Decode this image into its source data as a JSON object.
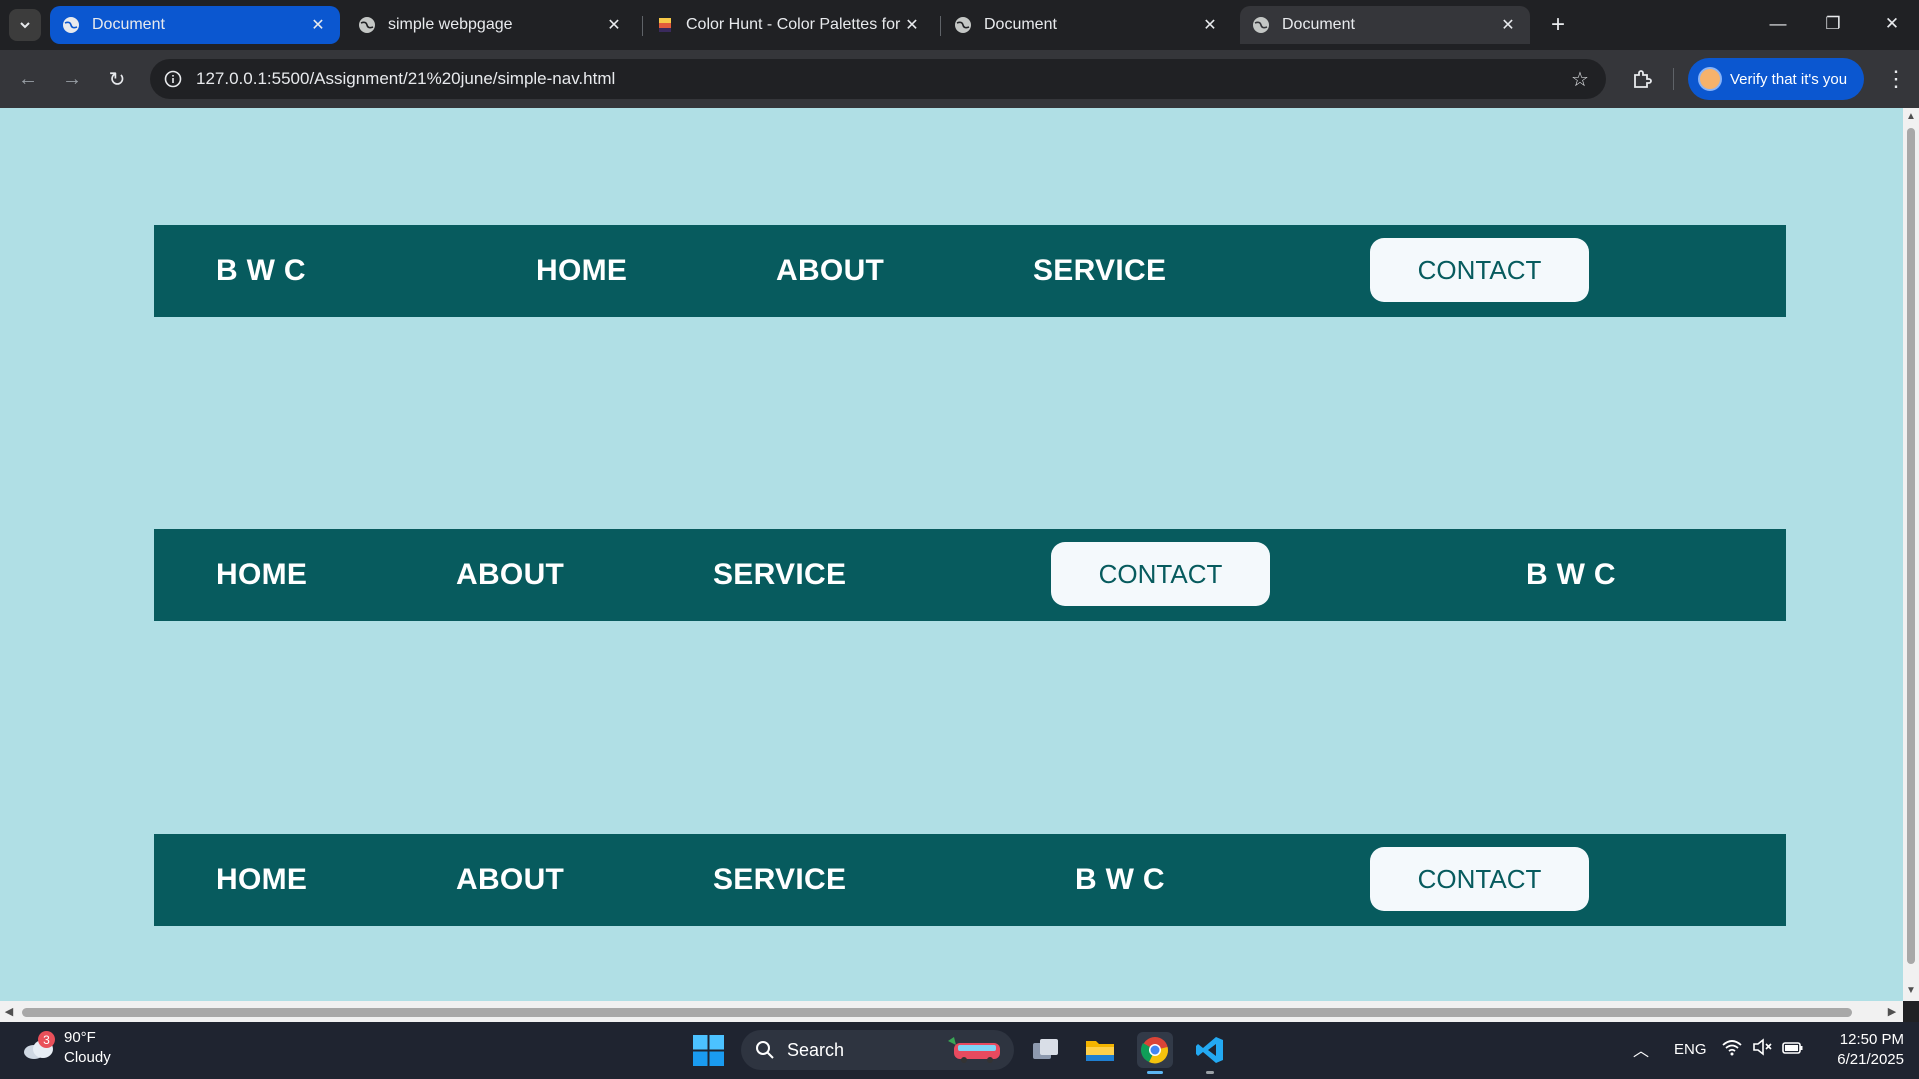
{
  "browser": {
    "tabs": [
      {
        "title": "Document",
        "favicon": "globe-icon",
        "state": "active"
      },
      {
        "title": "simple webpgage",
        "favicon": "globe-icon",
        "state": "inactive"
      },
      {
        "title": "Color Hunt - Color Palettes for I",
        "favicon": "colorhunt-icon",
        "state": "inactive"
      },
      {
        "title": "Document",
        "favicon": "globe-icon",
        "state": "inactive"
      },
      {
        "title": "Document",
        "favicon": "globe-icon",
        "state": "selected"
      }
    ],
    "url": "127.0.0.1:5500/Assignment/21%20june/simple-nav.html",
    "profile_button": "Verify that it's you"
  },
  "page": {
    "background": "#b0dfe5",
    "nav_color": "#075b5e",
    "button_color": "#f4f9fc",
    "navbar1": {
      "brand": "B W C",
      "home": "HOME",
      "about": "ABOUT",
      "service": "SERVICE",
      "contact": "CONTACT"
    },
    "navbar2": {
      "home": "HOME",
      "about": "ABOUT",
      "service": "SERVICE",
      "contact": "CONTACT",
      "brand": "B W C"
    },
    "navbar3": {
      "home": "HOME",
      "about": "ABOUT",
      "service": "SERVICE",
      "brand": "B W C",
      "contact": "CONTACT"
    }
  },
  "taskbar": {
    "weather": {
      "badge": "3",
      "temp": "90°F",
      "condition": "Cloudy"
    },
    "search_label": "Search",
    "language": "ENG",
    "time": "12:50 PM",
    "date": "6/21/2025"
  }
}
